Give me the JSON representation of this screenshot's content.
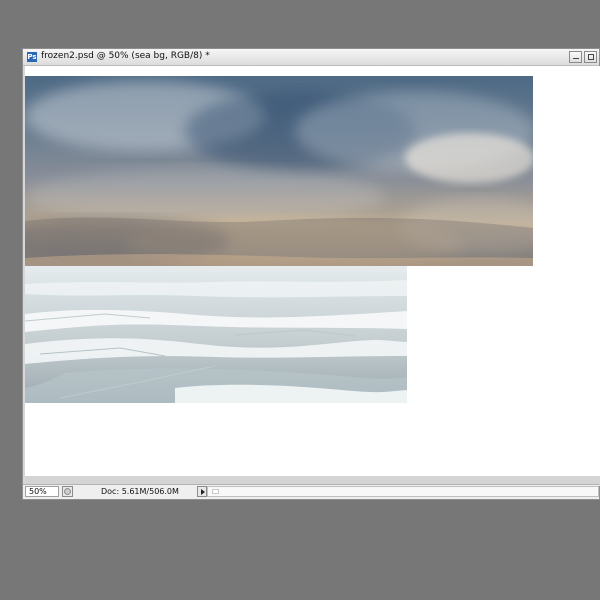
{
  "window": {
    "title": "frozen2.psd @ 50% (sea bg, RGB/8) *",
    "app_icon": "Ps"
  },
  "status": {
    "zoom": "50%",
    "doc_info": "Doc: 5.61M/506.0M"
  },
  "icons": {
    "app": "photoshop-icon",
    "minimize": "minimize-icon",
    "maximize": "maximize-icon",
    "status": "status-info-icon",
    "status_arrow": "chevron-right-icon"
  },
  "colors": {
    "workspace_bg": "#777777",
    "window_bg": "#d7d7d7",
    "canvas_bg": "#ffffff",
    "ps_blue": "#2b66b8"
  }
}
